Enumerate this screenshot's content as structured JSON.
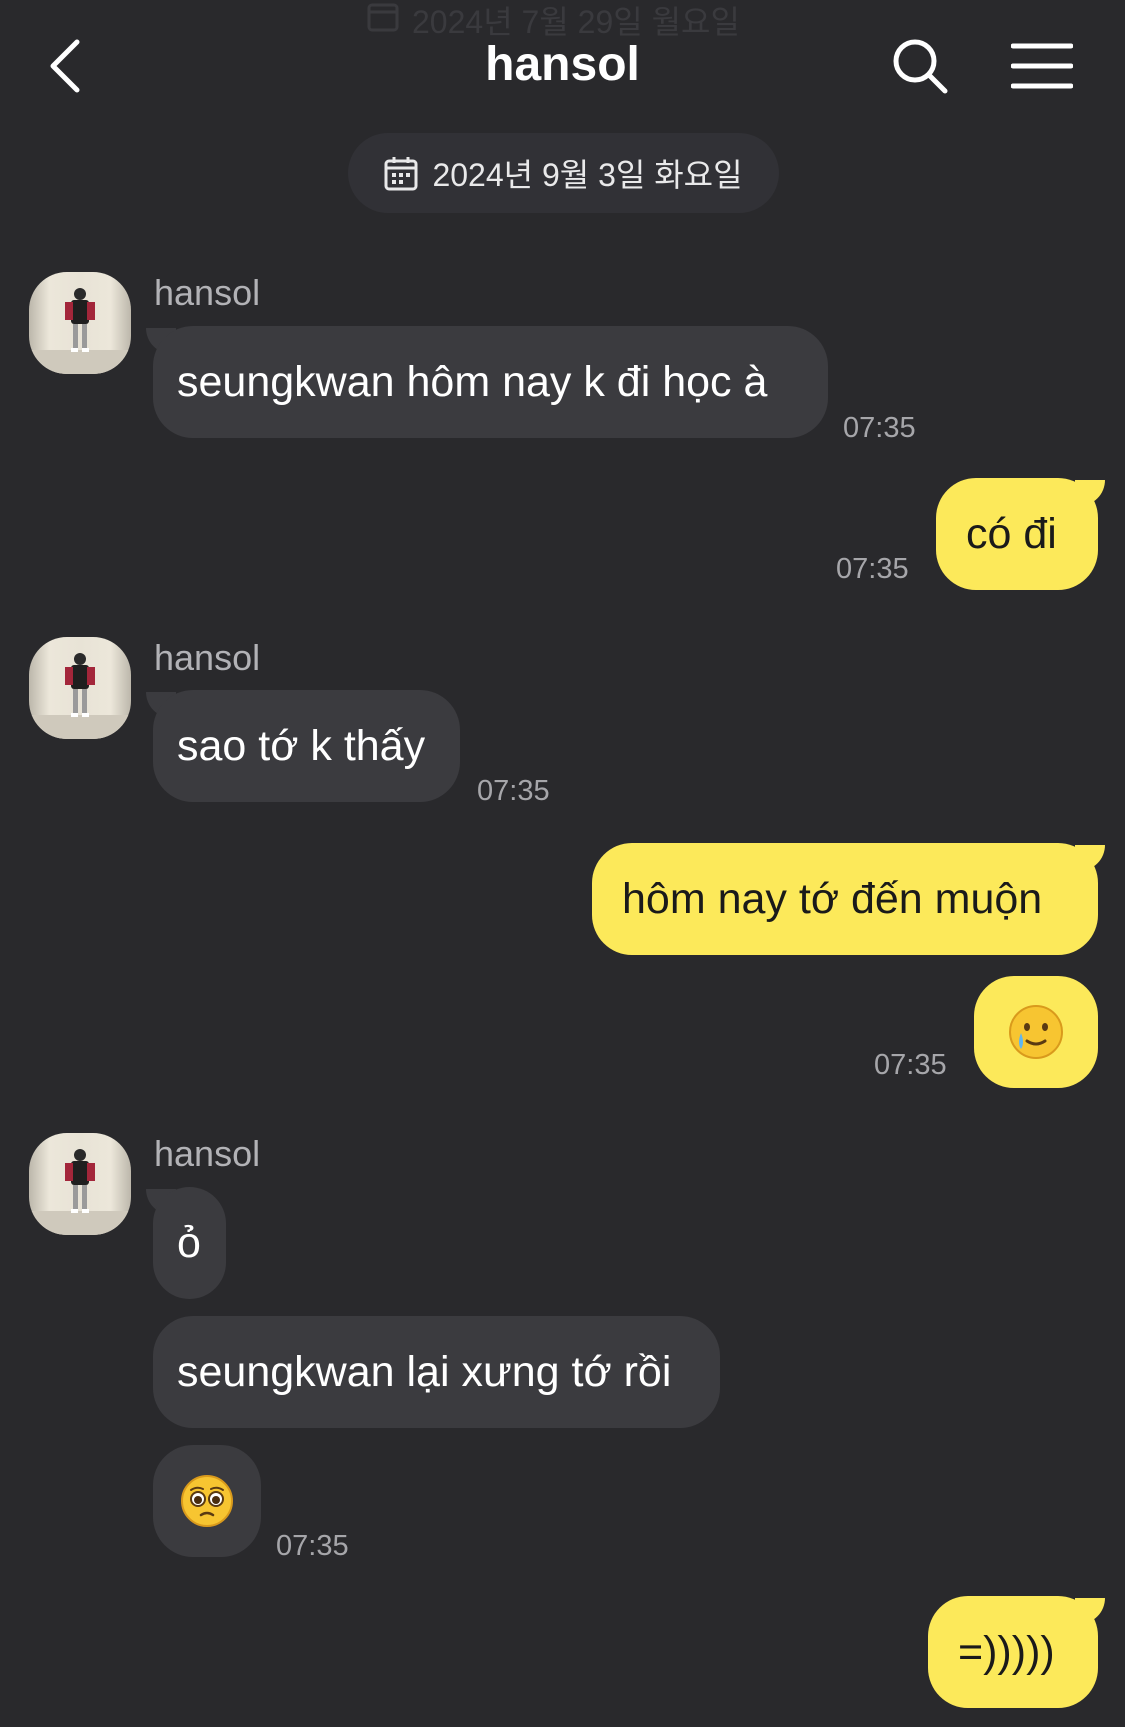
{
  "header": {
    "title": "hansol",
    "faded_date": "2024년 7월 29일 월요일",
    "back_icon": "chevron-left-icon",
    "search_icon": "search-icon",
    "menu_icon": "menu-icon"
  },
  "date_divider": "2024년 9월 3일 화요일",
  "messages": [
    {
      "sender": "hansol",
      "text": "seungkwan hôm nay k đi học à",
      "time": "07:35"
    },
    {
      "sender": "me",
      "text": "có đi",
      "time": "07:35"
    },
    {
      "sender": "hansol",
      "text": "sao tớ k thấy",
      "time": "07:35"
    },
    {
      "sender": "me",
      "text": "hôm nay tớ đến muộn"
    },
    {
      "sender": "me",
      "emoji": "crying-smile-emoji",
      "time": "07:35"
    },
    {
      "sender": "hansol",
      "text": "ỏ"
    },
    {
      "sender": "hansol",
      "text": "seungkwan lại xưng tớ rồi"
    },
    {
      "sender": "hansol",
      "emoji": "pleading-face-emoji",
      "time": "07:35"
    },
    {
      "sender": "me",
      "text": "=)))))"
    }
  ],
  "colors": {
    "background": "#29292c",
    "incoming_bubble": "#3b3b3f",
    "outgoing_bubble": "#fce95a",
    "timestamp": "#a6a6aa"
  }
}
